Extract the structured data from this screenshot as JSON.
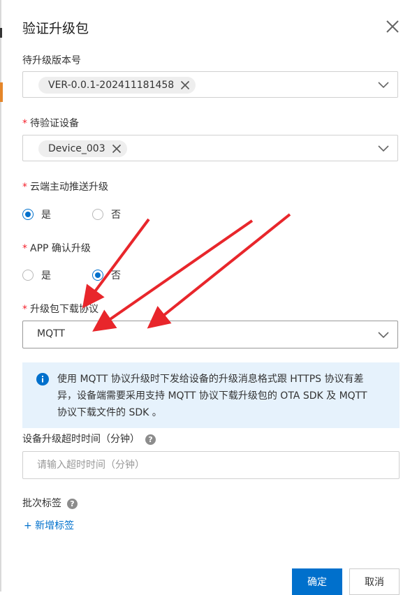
{
  "dialog": {
    "title": "验证升级包"
  },
  "fields": {
    "version": {
      "label": "待升级版本号",
      "tag": "VER-0.0.1-202411181458"
    },
    "device": {
      "label": "待验证设备",
      "tag": "Device_003"
    },
    "cloud_push": {
      "label": "云端主动推送升级",
      "options": [
        "是",
        "否"
      ],
      "selected": "是"
    },
    "app_confirm": {
      "label": "APP 确认升级",
      "options": [
        "是",
        "否"
      ],
      "selected": "否"
    },
    "protocol": {
      "label": "升级包下载协议",
      "value": "MQTT"
    },
    "notice": "使用 MQTT 协议升级时下发给设备的升级消息格式跟 HTTPS 协议有差异，设备端需要采用支持 MQTT 协议下载升级包的 OTA SDK 及 MQTT 协议下载文件的 SDK 。",
    "timeout": {
      "label": "设备升级超时时间（分钟）",
      "placeholder": "请输入超时时间（分钟）",
      "value": ""
    },
    "batch_tag": {
      "label": "批次标签",
      "add_label": "+ 新增标签"
    }
  },
  "footer": {
    "ok_label": "确定",
    "cancel_label": "取消"
  },
  "colors": {
    "accent": "#0070cc",
    "required": "#f5222d",
    "info_bg": "#e6f2fc",
    "annotation_arrow": "#e8262b"
  },
  "icons": {
    "close": "close-icon",
    "chevron": "chevron-down-icon",
    "tag_remove": "close-icon",
    "info": "info-icon",
    "help": "question-icon"
  }
}
